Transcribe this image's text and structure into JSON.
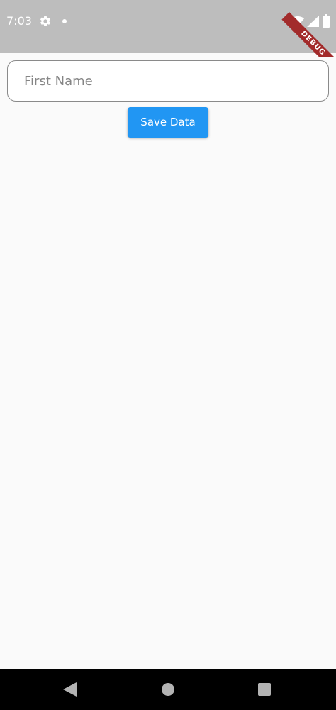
{
  "status_bar": {
    "time": "7:03",
    "background_color": "#bdbdbd",
    "icons": [
      "gear-icon",
      "dot-icon",
      "wifi-icon",
      "signal-icon",
      "battery-icon"
    ]
  },
  "debug_banner": {
    "label": "DEBUG",
    "color": "#a22b2b"
  },
  "form": {
    "first_name": {
      "placeholder": "First Name",
      "value": ""
    },
    "save_button": {
      "label": "Save Data",
      "color": "#2196f3"
    }
  },
  "nav_bar": {
    "icons": [
      "back-icon",
      "home-icon",
      "recents-icon"
    ]
  }
}
